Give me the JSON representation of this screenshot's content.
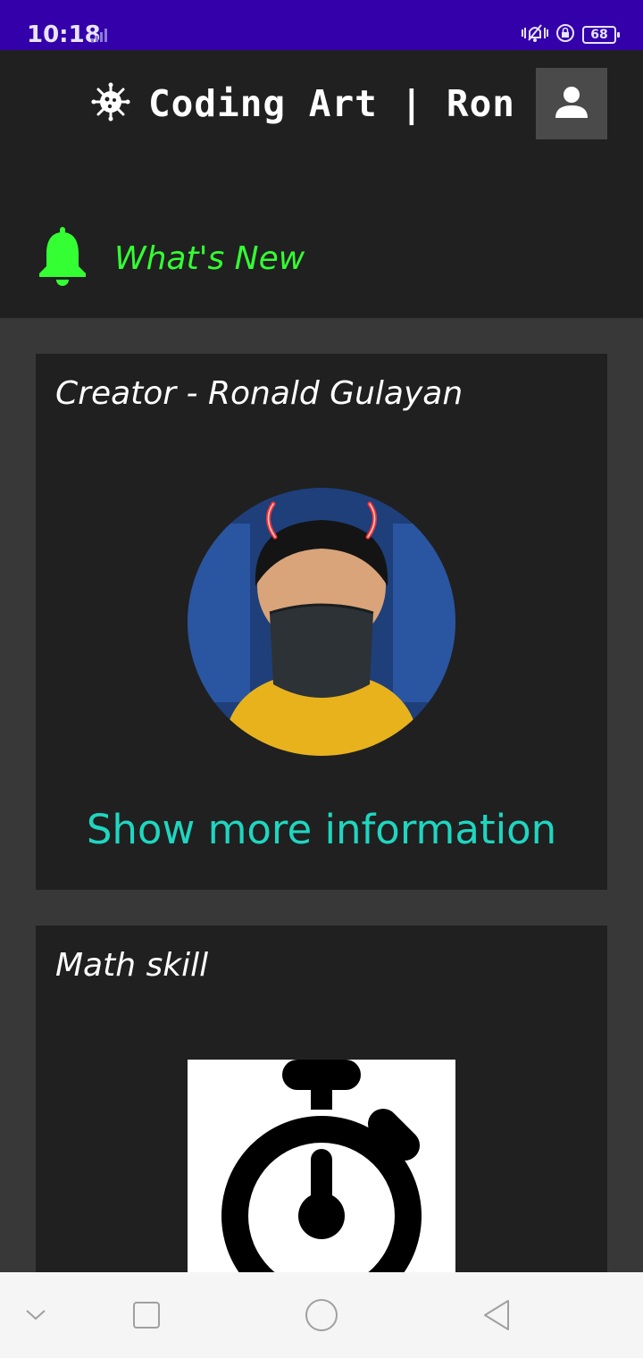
{
  "status_bar": {
    "time": "10:18",
    "battery": "68",
    "icons": [
      "signal-icon",
      "vibrate-icon",
      "rotation-lock-icon",
      "battery-icon"
    ]
  },
  "header": {
    "title": "Coding Art | Ron",
    "logo_icon": "virus-icon",
    "profile_icon": "person-icon"
  },
  "whats_new": {
    "label": "What's New",
    "icon": "bell-icon",
    "color": "#33ff33"
  },
  "cards": [
    {
      "title": "Creator - Ronald Gulayan",
      "link": "Show more information",
      "link_color": "#1fd6c0"
    },
    {
      "title": "Math skill",
      "image_icon": "stopwatch-icon"
    }
  ],
  "nav_bar": {
    "icons": [
      "chevron-down-icon",
      "recents-icon",
      "home-icon",
      "back-icon"
    ]
  },
  "colors": {
    "status_bar": "#3300aa",
    "header_bg": "#202020",
    "page_bg": "#383838",
    "card_bg": "#202020"
  }
}
